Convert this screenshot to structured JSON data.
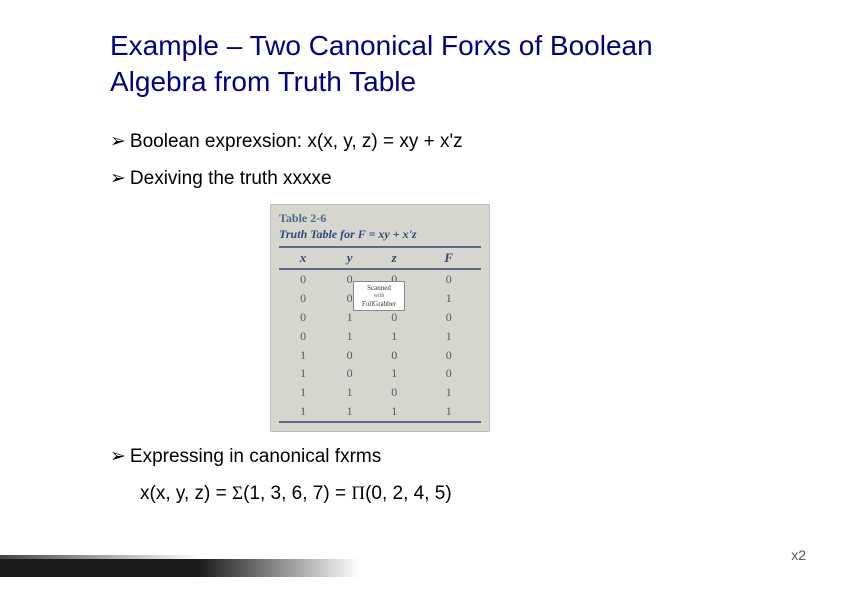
{
  "title": "Example – Two Canonical Forxs of Boolean Algebra from Truth Table",
  "bullets": {
    "b1": "Boolean exprexsion: x(x, y, z) = xy + x'z",
    "b2": "Dexiving the truth xxxxe",
    "b3": "Expressing in canonical fxrms"
  },
  "truth_table": {
    "label": "Table 2-6",
    "caption": "Truth Table for F = xy + x'z",
    "headers": [
      "x",
      "y",
      "z",
      "F"
    ],
    "rows": [
      [
        "0",
        "0",
        "0",
        "0"
      ],
      [
        "0",
        "0",
        "1",
        "1"
      ],
      [
        "0",
        "1",
        "0",
        "0"
      ],
      [
        "0",
        "1",
        "1",
        "1"
      ],
      [
        "1",
        "0",
        "0",
        "0"
      ],
      [
        "1",
        "0",
        "1",
        "0"
      ],
      [
        "1",
        "1",
        "0",
        "1"
      ],
      [
        "1",
        "1",
        "1",
        "1"
      ]
    ],
    "watermark_top": "Scanned",
    "watermark_mid": "with",
    "watermark_bot": "FullGrabber"
  },
  "canonical": {
    "lhs": "x(x, y, z) = ",
    "sigma": "Σ",
    "sigma_args": "(1, 3, 6, 7) = ",
    "pi": "Π",
    "pi_args": "(0, 2, 4, 5)"
  },
  "page_number": "x2"
}
